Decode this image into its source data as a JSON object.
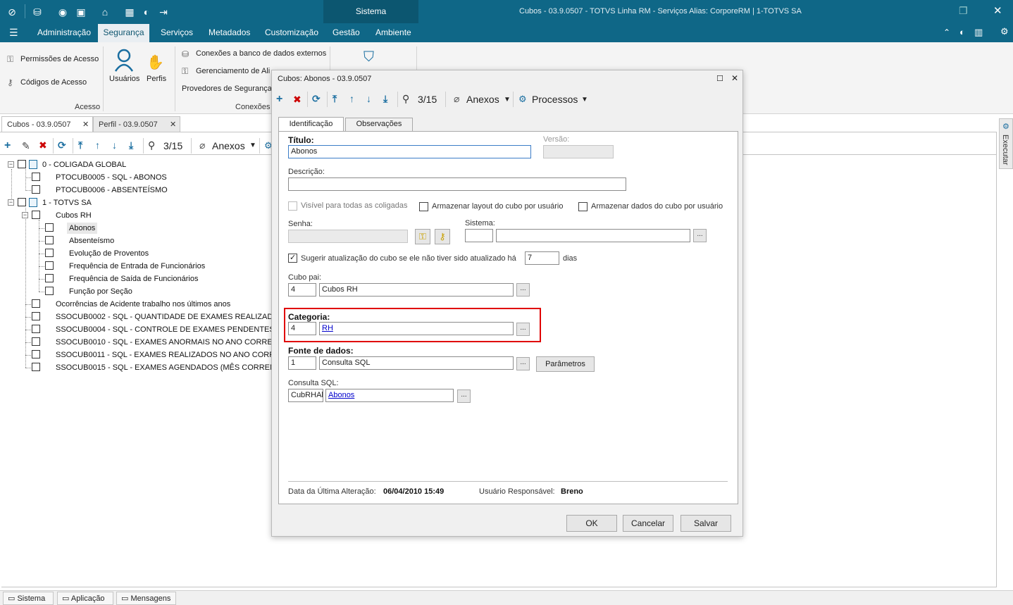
{
  "window": {
    "title": "Cubos - 03.9.0507 - TOTVS Linha RM - Serviços  Alias: CorporeRM | 1-TOTVS SA",
    "module": "Sistema"
  },
  "menu": {
    "items": [
      "Administração",
      "Segurança",
      "Serviços",
      "Metadados",
      "Customização",
      "Gestão",
      "Ambiente"
    ],
    "active": "Segurança"
  },
  "ribbon": {
    "acesso": {
      "permissoes": "Permissões de Acesso",
      "codigos": "Códigos de Acesso",
      "usuarios": "Usuários",
      "perfis": "Perfis",
      "group_label": "Acesso"
    },
    "conexoes": {
      "externos": "Conexões a banco de dados externos",
      "gerenciamento": "Gerenciamento de Ali",
      "provedores": "Provedores de Segurança",
      "group_label": "Conexões"
    }
  },
  "doc_tabs": [
    "Cubos - 03.9.0507",
    "Perfil - 03.9.0507"
  ],
  "toolbar": {
    "counter": "3/15",
    "anexos": "Anexos"
  },
  "tree": {
    "root0": "0 - COLIGADA GLOBAL",
    "root0_children": [
      "PTOCUB0005 - SQL - ABONOS",
      "PTOCUB0006 - ABSENTEÍSMO"
    ],
    "root1": "1 - TOTVS SA",
    "cubos_rh": "Cubos RH",
    "cubos_rh_children": [
      "Abonos",
      "Absenteísmo",
      "Evolução de Proventos",
      "Frequência de Entrada de Funcionários",
      "Frequência de Saída de Funcionários",
      "Função por Seção"
    ],
    "root1_children": [
      "Ocorrências de Acidente trabalho nos últimos anos",
      "SSOCUB0002 - SQL - QUANTIDADE DE EXAMES REALIZAD",
      "SSOCUB0004 - SQL - CONTROLE DE EXAMES PENDENTES",
      "SSOCUB0010 - SQL - EXAMES ANORMAIS NO ANO CORRE",
      "SSOCUB0011 - SQL - EXAMES REALIZADOS NO ANO CORR",
      "SSOCUB0015 - SQL - EXAMES AGENDADOS (MÊS CORREN"
    ]
  },
  "side_panel": {
    "label": "Executar"
  },
  "dialog": {
    "title": "Cubos: Abonos - 03.9.0507",
    "counter": "3/15",
    "anexos": "Anexos",
    "processos": "Processos",
    "tabs": [
      "Identificação",
      "Observações"
    ],
    "titulo_label": "Título:",
    "titulo_value": "Abonos",
    "versao_label": "Versão:",
    "descricao_label": "Descrição:",
    "descricao_value": "",
    "visivel_label": "Visível para  todas as coligadas",
    "layout_label": "Armazenar layout do cubo por usuário",
    "dados_label": "Armazenar dados do cubo por usuário",
    "senha_label": "Senha:",
    "sistema_label": "Sistema:",
    "sugerir_label": "Sugerir atualização do cubo se ele não tiver sido atualizado há",
    "sugerir_dias": "7",
    "dias_label": "dias",
    "cubo_pai_label": "Cubo pai:",
    "cubo_pai_code": "4",
    "cubo_pai_name": "Cubos RH",
    "categoria_label": "Categoria:",
    "categoria_code": "4",
    "categoria_name": "RH",
    "fonte_label": "Fonte de dados:",
    "fonte_code": "1",
    "fonte_name": "Consulta SQL",
    "parametros": "Parâmetros",
    "consulta_label": "Consulta SQL:",
    "consulta_code": "CubRHAb",
    "consulta_name": "Abonos",
    "ultima_alt_label": "Data da Última Alteração:",
    "ultima_alt_value": "06/04/2010 15:49",
    "usuario_label": "Usuário Responsável:",
    "usuario_value": "Breno",
    "ok": "OK",
    "cancelar": "Cancelar",
    "salvar": "Salvar",
    "dots": "..."
  },
  "statusbar": {
    "items": [
      "Sistema",
      "Aplicação",
      "Mensagens"
    ]
  },
  "colors": {
    "brand": "#0f6787",
    "highlight": "#e00000"
  }
}
